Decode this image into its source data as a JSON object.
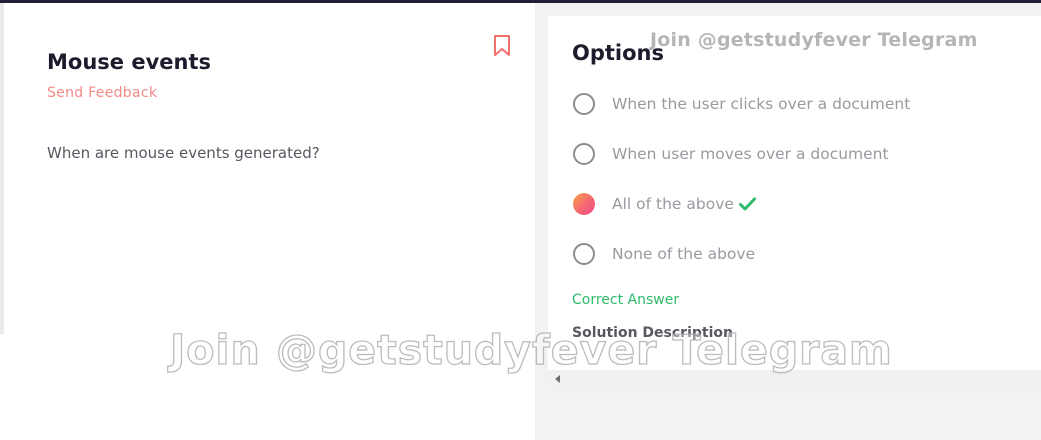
{
  "question": {
    "title": "Mouse events",
    "feedback_label": "Send Feedback",
    "text": "When are mouse events generated?",
    "bookmark_icon": "bookmark-icon"
  },
  "options": {
    "title": "Options",
    "items": [
      {
        "label": "When the user clicks over a document",
        "selected": false
      },
      {
        "label": "When user moves over a document",
        "selected": false
      },
      {
        "label": "All of the above",
        "selected": true,
        "correct": true
      },
      {
        "label": "None of the above",
        "selected": false
      }
    ],
    "correct_answer_label": "Correct Answer",
    "solution_label": "Solution Description"
  },
  "watermark": {
    "top": "Join @getstudyfever Telegram",
    "big": "Join @getstudyfever Telegram"
  },
  "colors": {
    "accent": "#f48a86",
    "correct": "#2fb96a",
    "topbar": "#241d35"
  }
}
